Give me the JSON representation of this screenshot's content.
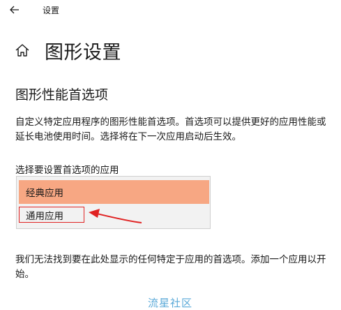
{
  "window": {
    "title": "设置"
  },
  "header": {
    "title": "图形设置"
  },
  "section": {
    "title": "图形性能首选项",
    "description": "自定义特定应用程序的图形性能首选项。首选项可以提供更好的应用性能或延长电池使用时间。选择将在下一次应用启动后生效。"
  },
  "app_selector": {
    "label": "选择要设置首选项的应用",
    "options": [
      {
        "label": "经典应用",
        "highlighted": true
      },
      {
        "label": "通用应用",
        "highlighted": false,
        "annotated": true
      }
    ]
  },
  "empty_message": "我们无法找到要在此处显示的任何特定于应用的首选项。添加一个应用以开始。",
  "watermark": "流星社区",
  "colors": {
    "highlight": "#f7a783",
    "annotation": "#e02222",
    "watermark": "#5aa9d8"
  },
  "icons": {
    "back": "back-arrow-icon",
    "home": "home-icon"
  }
}
